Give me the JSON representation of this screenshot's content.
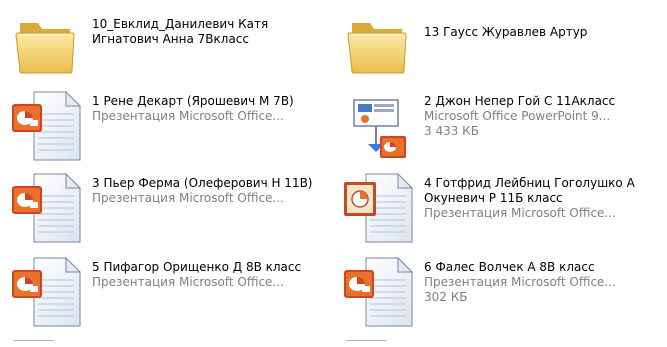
{
  "items": [
    {
      "name": "10_Евклид_Данилевич Катя Игнатович Анна 7Вкласс",
      "kind": "folder",
      "type_label": "",
      "size": ""
    },
    {
      "name": "13 Гаусс Журавлев Артур",
      "kind": "folder",
      "type_label": "",
      "size": ""
    },
    {
      "name": "1 Рене Декарт (Ярошевич М 7В)",
      "kind": "pps",
      "type_label": "Презентация Microsoft Office...",
      "size": ""
    },
    {
      "name": "2 Джон Непер Гой С  11Акласс",
      "kind": "ppt",
      "type_label": "Microsoft Office PowerPoint 9...",
      "size": "3 433 КБ"
    },
    {
      "name": "3 Пьер Ферма (Олеферович Н 11В)",
      "kind": "pps",
      "type_label": "Презентация Microsoft Office...",
      "size": ""
    },
    {
      "name": "4 Готфрид Лейбниц Гоголушко А Окуневич Р 11Б класс",
      "kind": "pps-alt",
      "type_label": "Презентация Microsoft Office...",
      "size": ""
    },
    {
      "name": "5 Пифагор Орищенко Д  8В класс",
      "kind": "pps",
      "type_label": "Презентация Microsoft Office...",
      "size": ""
    },
    {
      "name": "6 Фалес Волчек А 8В класс",
      "kind": "pps",
      "type_label": "Презентация Microsoft Office...",
      "size": "302 КБ"
    }
  ],
  "icons": {
    "folder": "folder-icon",
    "pps": "powerpoint-show-icon",
    "ppt": "powerpoint-presentation-icon",
    "pps-alt": "powerpoint-show-icon"
  },
  "colors": {
    "folder_fill": "#F5D76E",
    "folder_dark": "#D9A93A",
    "pp_red": "#D04423",
    "pp_orange": "#E8712B",
    "secondary_text": "#808080"
  }
}
